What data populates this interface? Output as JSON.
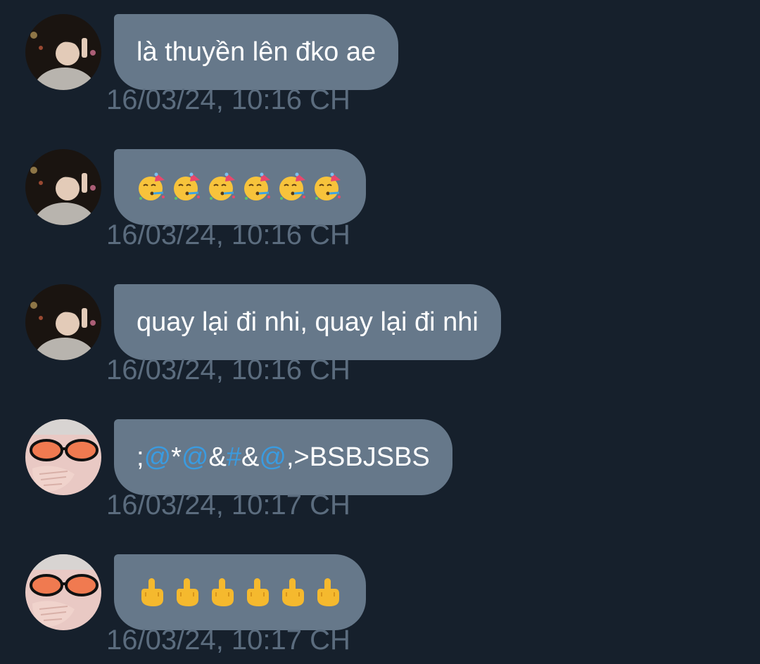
{
  "messages": [
    {
      "id": "m1",
      "avatar": "avatar-user-a",
      "text": "là thuyền lên đko ae",
      "timestamp": "16/03/24, 10:16 CH"
    },
    {
      "id": "m2",
      "avatar": "avatar-user-a",
      "emoji": "partying-face-icon",
      "emoji_count": 6,
      "timestamp": "16/03/24, 10:16 CH"
    },
    {
      "id": "m3",
      "avatar": "avatar-user-a",
      "text": "quay lại đi nhi, quay lại đi nhi",
      "timestamp": "16/03/24, 10:16 CH"
    },
    {
      "id": "m4",
      "avatar": "avatar-user-b",
      "text_parts": [
        ";",
        "@",
        "*",
        "@",
        "&",
        "#",
        "&",
        "@",
        ",>BSBJSBS"
      ],
      "timestamp": "16/03/24, 10:17 CH"
    },
    {
      "id": "m5",
      "avatar": "avatar-user-b",
      "emoji": "middle-finger-icon",
      "emoji_count": 6,
      "timestamp": "16/03/24, 10:17 CH"
    }
  ],
  "colors": {
    "background": "#16202c",
    "bubble": "#66788a",
    "timestamp": "#5b6c7e",
    "mention": "#3a9be0"
  }
}
